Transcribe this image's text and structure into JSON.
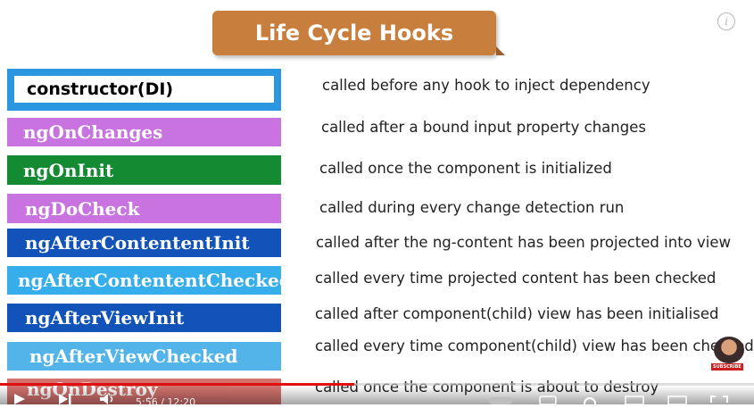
{
  "title": "Life Cycle Hooks",
  "hooks": [
    {
      "name": "constructor(DI)",
      "desc": "called before any hook to inject dependency",
      "color": "#2b97e0"
    },
    {
      "name": "ngOnChanges",
      "desc": "called after a bound input property changes",
      "color": "#c873e0"
    },
    {
      "name": "ngOnInit",
      "desc": "called once the component is initialized",
      "color": "#148a33"
    },
    {
      "name": "ngDoCheck",
      "desc": "called during every change detection run",
      "color": "#c873e0"
    },
    {
      "name": "ngAfterContententInit",
      "desc": "called after the ng-content has been projected into view",
      "color": "#1153b8"
    },
    {
      "name": "ngAfterContententChecked",
      "desc": "called every time projected content has been checked",
      "color": "#35aeeb"
    },
    {
      "name": "ngAfterViewInit",
      "desc": "called after component(child) view has been initialised",
      "color": "#1153b8"
    },
    {
      "name": "ngAfterViewChecked",
      "desc": "called every time component(child) view has been checked",
      "color": "#35a8e6"
    },
    {
      "name": "ngOnDestroy",
      "desc": "called once the component is about to destroy",
      "color": "#c9504a"
    }
  ],
  "player": {
    "timecode": "5:56 / 12:20",
    "progress": 0.47,
    "subscribe_label": "SUBSCRIBE",
    "info_icon": "i"
  }
}
